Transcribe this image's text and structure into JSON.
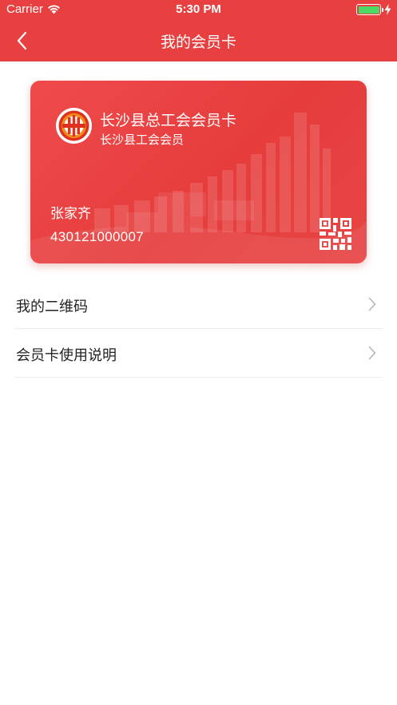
{
  "status_bar": {
    "carrier": "Carrier",
    "time": "5:30 PM",
    "battery_level": 1.0,
    "battery_color": "#4cd964"
  },
  "nav": {
    "title": "我的会员卡",
    "back_icon": "chevron-left-icon"
  },
  "colors": {
    "brand": "#e84040",
    "card": "#e84545",
    "text": "#222222",
    "divider": "#ececec",
    "chevron": "#b5b5b5"
  },
  "card": {
    "title": "长沙县总工会会员卡",
    "subtitle": "长沙县工会会员",
    "holder_name": "张家齐",
    "card_number": "430121000007",
    "logo_icon": "trade-union-logo-icon",
    "qr_icon": "qr-code-icon"
  },
  "menu": {
    "items": [
      {
        "label": "我的二维码",
        "icon": "chevron-right-icon"
      },
      {
        "label": "会员卡使用说明",
        "icon": "chevron-right-icon"
      }
    ]
  }
}
